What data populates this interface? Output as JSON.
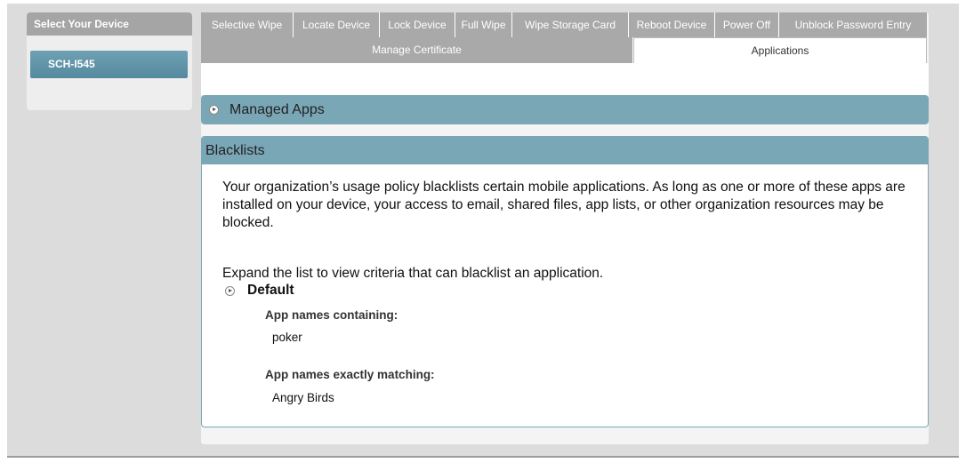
{
  "sidebar": {
    "header": "Select Your Device",
    "devices": [
      "SCH-I545"
    ]
  },
  "tabs_row1": [
    "Selective Wipe",
    "Locate Device",
    "Lock Device",
    "Full Wipe",
    "Wipe Storage Card",
    "Reboot Device",
    "Power Off",
    "Unblock Password Entry"
  ],
  "tabs_row2": {
    "manage_certificate": "Manage Certificate",
    "applications": "Applications",
    "active": "Applications"
  },
  "managed_apps": {
    "label": "Managed Apps",
    "expand_icon": "expand-arrow-icon"
  },
  "blacklists": {
    "header": "Blacklists",
    "description": "Your organization’s usage policy blacklists certain mobile applications. As long as one or more of these apps are installed on your device, your access to email, shared files, app lists, or other organization resources may be blocked.",
    "expand_hint": "Expand the list to view criteria that can blacklist an application.",
    "policy_name": "Default",
    "containing_label": "App names containing:",
    "containing_value": "poker",
    "exact_label": "App names exactly matching:",
    "exact_value": "Angry Birds"
  },
  "colors": {
    "accent": "#7aa7b6",
    "tab_gray": "#a9a9a9",
    "device_selected": "#5f93a7"
  }
}
